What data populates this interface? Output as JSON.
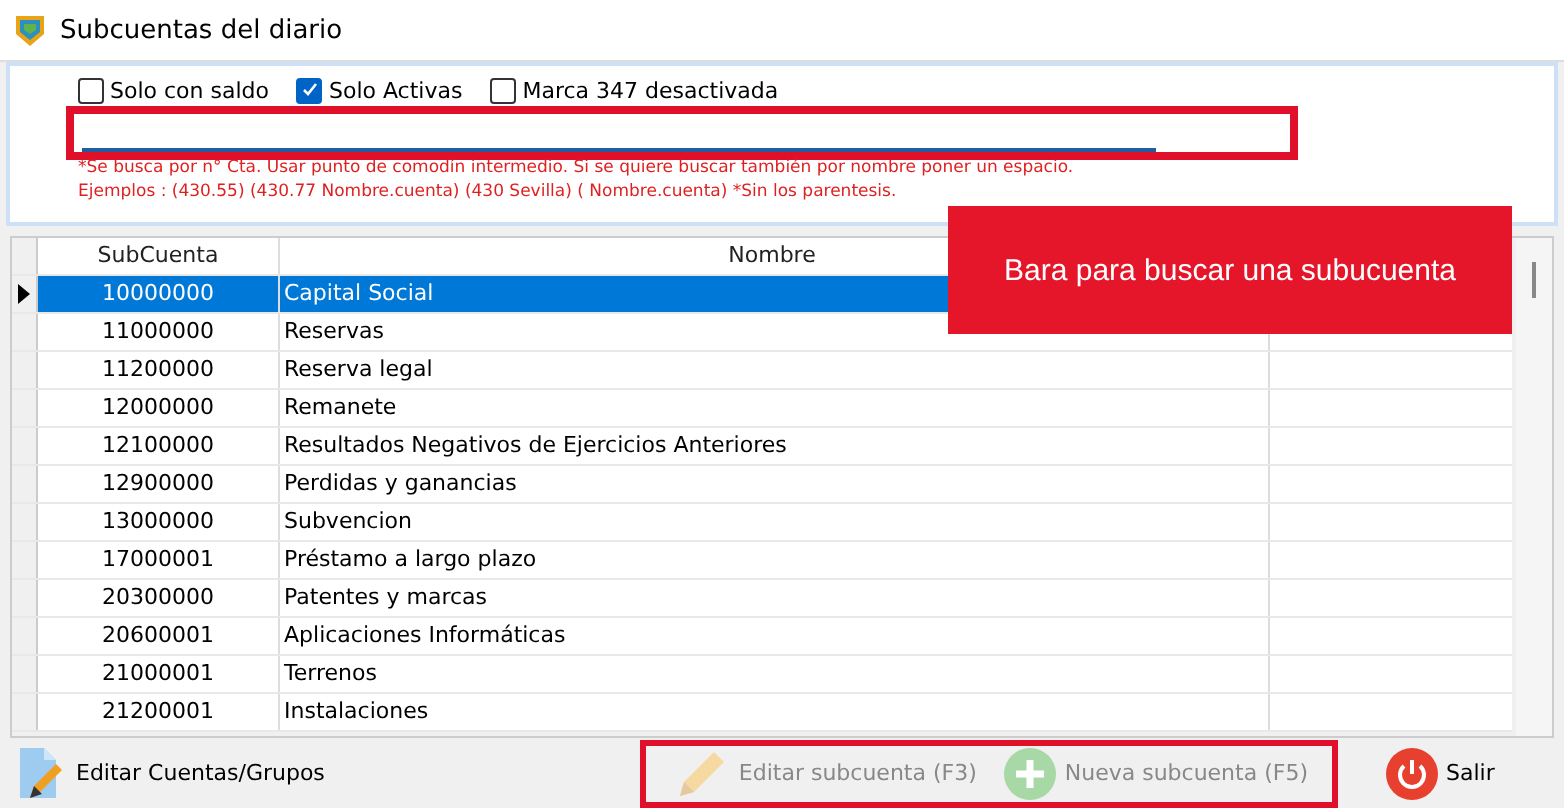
{
  "window": {
    "title": "Subcuentas del diario"
  },
  "filters": [
    {
      "label": "Solo con saldo",
      "checked": false
    },
    {
      "label": "Solo Activas",
      "checked": true
    },
    {
      "label": "Marca 347 desactivada",
      "checked": false
    }
  ],
  "hints": [
    "*Se busca por n° Cta. Usar punto de comodín intermedio. Si se quiere buscar también por nombre poner un espacio.",
    "Ejemplos : (430.55) (430.77 Nombre.cuenta) (430 Sevilla)  (   Nombre.cuenta) *Sin los parentesis."
  ],
  "callout": "Bara para buscar una subucuenta",
  "table": {
    "columns": [
      "SubCuenta",
      "Nombre"
    ],
    "rows": [
      {
        "cells": [
          "10000000",
          "Capital Social"
        ],
        "selected": true
      },
      {
        "cells": [
          "11000000",
          "Reservas"
        ],
        "selected": false
      },
      {
        "cells": [
          "11200000",
          "Reserva legal"
        ],
        "selected": false
      },
      {
        "cells": [
          "12000000",
          "Remanete"
        ],
        "selected": false
      },
      {
        "cells": [
          "12100000",
          "Resultados Negativos de Ejercicios Anteriores"
        ],
        "selected": false
      },
      {
        "cells": [
          "12900000",
          "Perdidas y ganancias"
        ],
        "selected": false
      },
      {
        "cells": [
          "13000000",
          "Subvencion"
        ],
        "selected": false
      },
      {
        "cells": [
          "17000001",
          "Préstamo a largo plazo"
        ],
        "selected": false
      },
      {
        "cells": [
          "20300000",
          "Patentes y marcas"
        ],
        "selected": false
      },
      {
        "cells": [
          "20600001",
          "Aplicaciones Informáticas"
        ],
        "selected": false
      },
      {
        "cells": [
          "21000001",
          "Terrenos"
        ],
        "selected": false
      },
      {
        "cells": [
          "21200001",
          "Instalaciones"
        ],
        "selected": false
      }
    ]
  },
  "buttons": [
    {
      "kind": "edit-groups",
      "label": "Editar Cuentas/Grupos",
      "disabled": false
    },
    {
      "kind": "edit",
      "label": "Editar subcuenta (F3)",
      "disabled": true
    },
    {
      "kind": "new",
      "label": "Nueva subcuenta (F5)",
      "disabled": true
    },
    {
      "kind": "exit",
      "label": "Salir",
      "disabled": false
    }
  ]
}
